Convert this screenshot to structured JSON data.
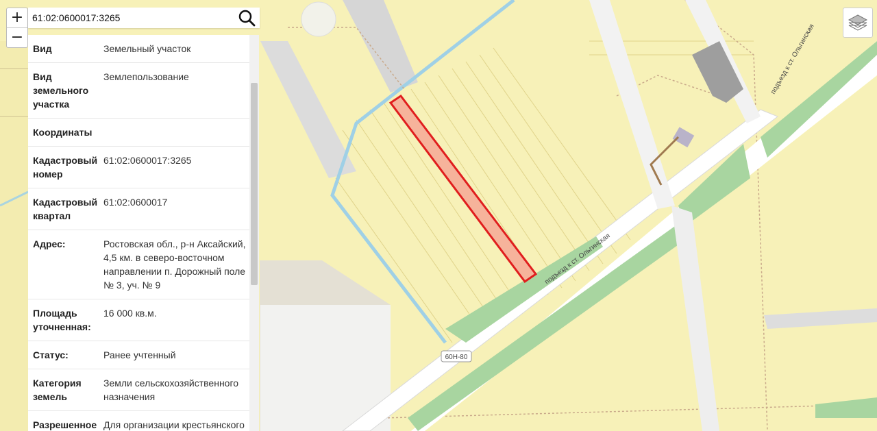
{
  "search": {
    "value": "61:02:0600017:3265"
  },
  "zoom": {
    "in_label": "+",
    "out_label": "−"
  },
  "icons": {
    "search": "search-icon",
    "layers": "layers-icon"
  },
  "details": [
    {
      "key": "Вид",
      "value": "Земельный участок"
    },
    {
      "key": "Вид земельного участка",
      "value": "Землепользование"
    },
    {
      "key": "Координаты",
      "value": ""
    },
    {
      "key": "Кадастровый номер",
      "value": "61:02:0600017:3265"
    },
    {
      "key": "Кадастровый квартал",
      "value": "61:02:0600017"
    },
    {
      "key": "Адрес:",
      "value": "Ростовская обл., р-н Аксайский, 4,5 км. в северо-восточном направлении п. Дорожный поле № 3, уч. № 9"
    },
    {
      "key": "Площадь уточненная:",
      "value": "16 000 кв.м."
    },
    {
      "key": "Статус:",
      "value": "Ранее учтенный"
    },
    {
      "key": "Категория земель",
      "value": "Земли сельскохозяйственного назначения"
    },
    {
      "key": "Разрешенное",
      "value": "Для организации крестьянского"
    }
  ],
  "map": {
    "road_name": "подъезд к ст. Ольгинская",
    "road_name_upper": "подъезд к ст. Ольгинская",
    "road_number": "60Н-80",
    "colors": {
      "parcel_fill": "#f6b39b",
      "parcel_stroke": "#e01e1e",
      "land": "#f7f1b8",
      "green": "#a8d5a0"
    }
  }
}
